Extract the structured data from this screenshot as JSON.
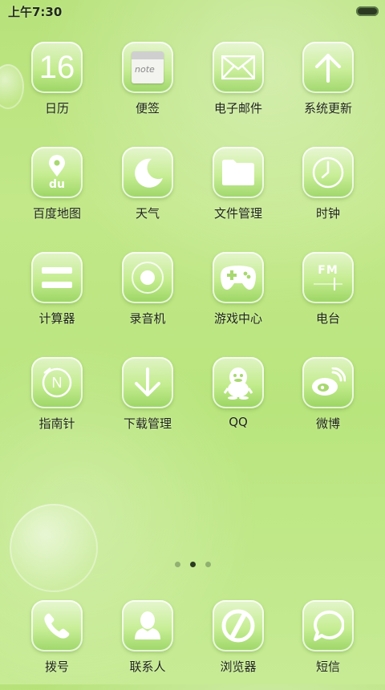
{
  "status_bar": {
    "time": "上午7:30"
  },
  "apps": [
    [
      {
        "label": "日历",
        "icon": "calendar-icon",
        "num": "16"
      },
      {
        "label": "便签",
        "icon": "note-icon",
        "text": "note"
      },
      {
        "label": "电子邮件",
        "icon": "mail-icon"
      },
      {
        "label": "系统更新",
        "icon": "arrow-up-icon"
      }
    ],
    [
      {
        "label": "百度地图",
        "icon": "map-pin-icon",
        "text": "du"
      },
      {
        "label": "天气",
        "icon": "moon-icon"
      },
      {
        "label": "文件管理",
        "icon": "folder-icon"
      },
      {
        "label": "时钟",
        "icon": "clock-icon"
      }
    ],
    [
      {
        "label": "计算器",
        "icon": "equals-icon"
      },
      {
        "label": "录音机",
        "icon": "record-icon"
      },
      {
        "label": "游戏中心",
        "icon": "gamepad-icon"
      },
      {
        "label": "电台",
        "icon": "radio-fm-icon",
        "text": "FM"
      }
    ],
    [
      {
        "label": "指南针",
        "icon": "compass-icon",
        "text": "N"
      },
      {
        "label": "下载管理",
        "icon": "arrow-down-icon"
      },
      {
        "label": "QQ",
        "icon": "penguin-icon"
      },
      {
        "label": "微博",
        "icon": "weibo-icon"
      }
    ]
  ],
  "page_indicator": {
    "count": 3,
    "active": 2
  },
  "dock": [
    {
      "label": "拨号",
      "icon": "phone-icon"
    },
    {
      "label": "联系人",
      "icon": "contact-icon"
    },
    {
      "label": "浏览器",
      "icon": "browser-icon"
    },
    {
      "label": "短信",
      "icon": "message-icon"
    }
  ]
}
